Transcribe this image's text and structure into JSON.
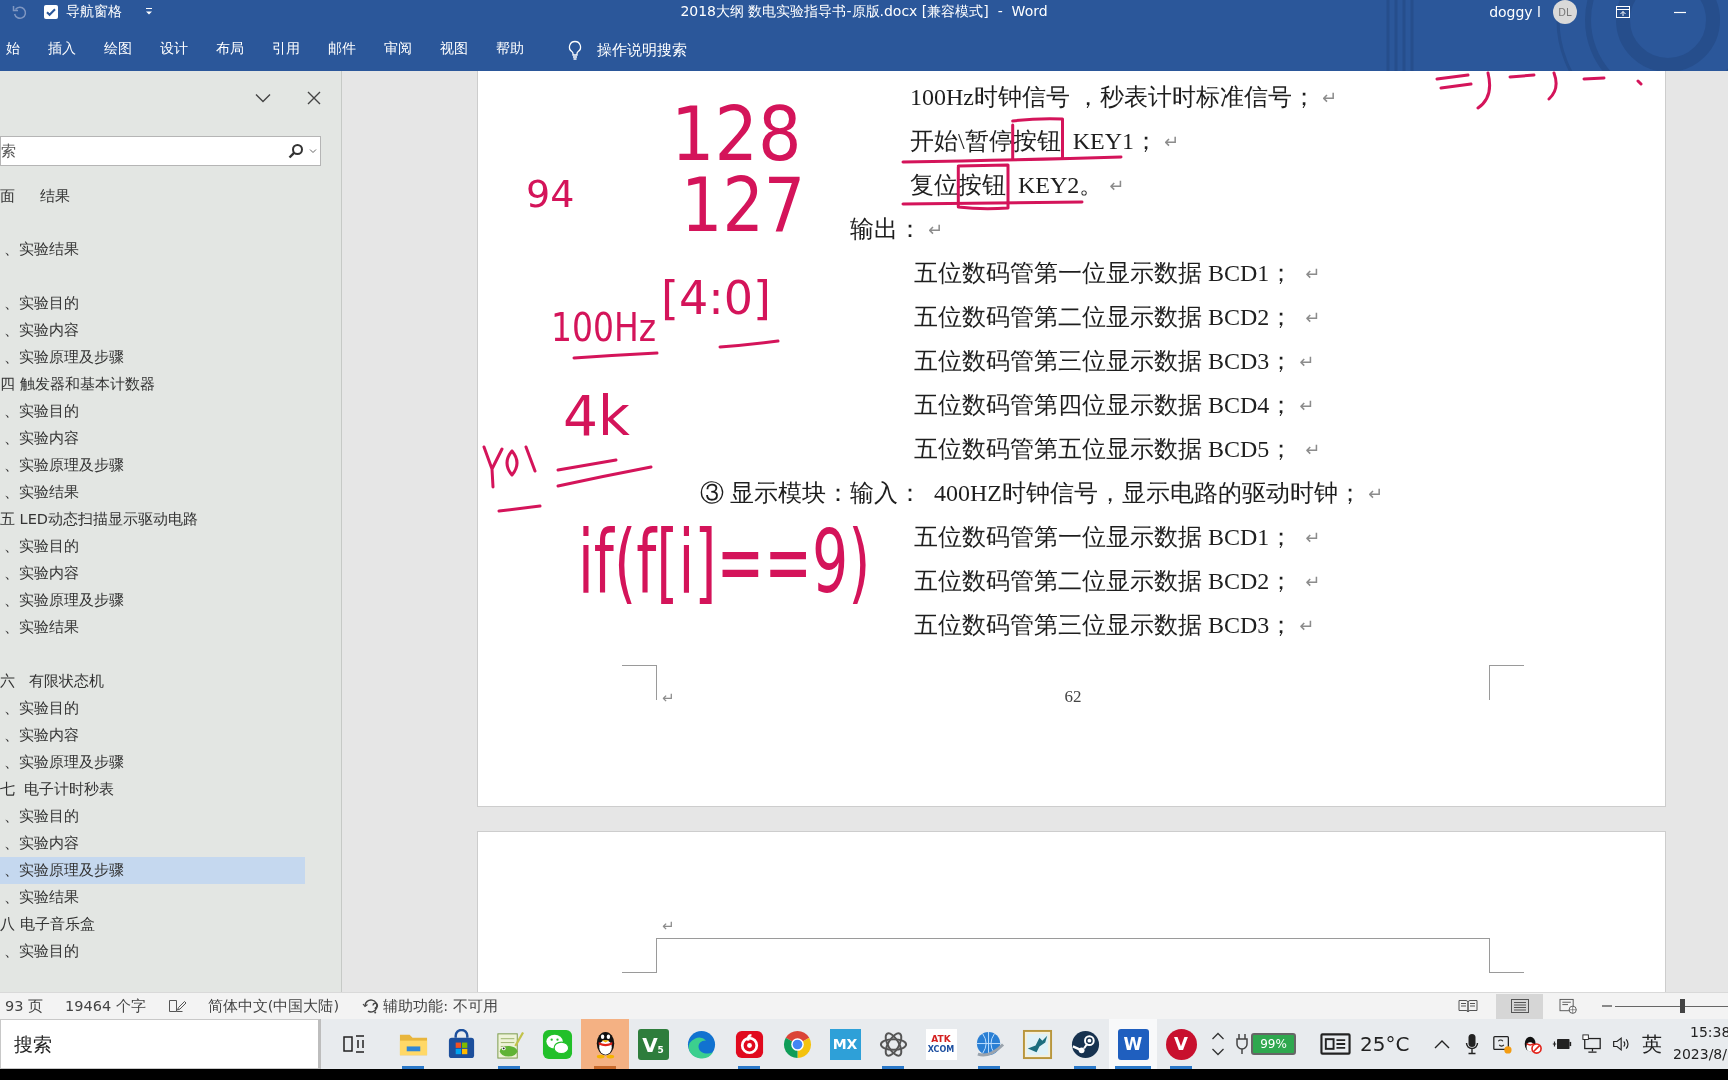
{
  "title_bar": {
    "undo": {
      "disabled": true
    },
    "nav_checkbox": {
      "label": "导航窗格",
      "checked": true
    },
    "title": "2018大纲 数电实验指导书-原版.docx [兼容模式]  -  Word",
    "user": "doggy l",
    "avatar": "DL"
  },
  "ribbon": {
    "tabs": [
      {
        "label": "始",
        "selected": false
      },
      {
        "label": "插入",
        "selected": false
      },
      {
        "label": "绘图",
        "selected": false
      },
      {
        "label": "设计",
        "selected": false
      },
      {
        "label": "布局",
        "selected": false
      },
      {
        "label": "引用",
        "selected": false
      },
      {
        "label": "邮件",
        "selected": false
      },
      {
        "label": "审阅",
        "selected": false
      },
      {
        "label": "视图",
        "selected": false
      },
      {
        "label": "帮助",
        "selected": false
      }
    ],
    "tell_me": "操作说明搜索"
  },
  "nav_pane": {
    "search": {
      "placeholder": "索"
    },
    "tabs": [
      {
        "label": "面",
        "selected": false
      },
      {
        "label": "结果",
        "selected": false
      }
    ],
    "tree": [
      {
        "kind": "entry",
        "text": "、实验结果",
        "selected": false
      },
      {
        "kind": "blank",
        "children": [
          {
            "kind": "entry",
            "text": "、实验目的",
            "selected": false
          },
          {
            "kind": "entry",
            "text": "、实验内容",
            "selected": false
          },
          {
            "kind": "entry",
            "text": "、实验原理及步骤",
            "selected": false
          }
        ]
      },
      {
        "kind": "heading",
        "text": "四 触发器和基本计数器",
        "selected": false,
        "children": [
          {
            "kind": "entry",
            "text": "、实验目的",
            "selected": false
          },
          {
            "kind": "entry",
            "text": "、实验内容",
            "selected": false
          },
          {
            "kind": "entry",
            "text": "、实验原理及步骤",
            "selected": false
          },
          {
            "kind": "entry",
            "text": "、实验结果",
            "selected": false
          }
        ]
      },
      {
        "kind": "heading",
        "text": "五 LED动态扫描显示驱动电路",
        "selected": false,
        "children": [
          {
            "kind": "entry",
            "text": "、实验目的",
            "selected": false
          },
          {
            "kind": "entry",
            "text": "、实验内容",
            "selected": false
          },
          {
            "kind": "entry",
            "text": "、实验原理及步骤",
            "selected": false
          },
          {
            "kind": "entry",
            "text": "、实验结果",
            "selected": false
          }
        ]
      },
      {
        "kind": "blank"
      },
      {
        "kind": "heading",
        "text": "六   有限状态机",
        "selected": false,
        "children": [
          {
            "kind": "entry",
            "text": "、实验目的",
            "selected": false
          },
          {
            "kind": "entry",
            "text": "、实验内容",
            "selected": false
          },
          {
            "kind": "entry",
            "text": "、实验原理及步骤",
            "selected": false
          }
        ]
      },
      {
        "kind": "heading",
        "text": "七  电子计时秒表",
        "selected": false,
        "children": [
          {
            "kind": "entry",
            "text": "、实验目的",
            "selected": false
          },
          {
            "kind": "entry",
            "text": "、实验内容",
            "selected": false
          },
          {
            "kind": "entry",
            "text": "、实验原理及步骤",
            "selected": true
          },
          {
            "kind": "entry",
            "text": "、实验结果",
            "selected": false
          }
        ]
      },
      {
        "kind": "heading",
        "text": "八 电子音乐盒",
        "selected": false,
        "children": [
          {
            "kind": "entry",
            "text": "、实验目的",
            "selected": false
          }
        ]
      }
    ]
  },
  "document": {
    "pages": [
      {
        "lines": [
          {
            "kind": "input",
            "text": "100Hz时钟信号 ，秒表计时标准信号；",
            "mark": "↵"
          },
          {
            "kind": "input",
            "text": "开始\\暂停按钮  KEY1；",
            "mark": "↵"
          },
          {
            "kind": "input",
            "text": "复位按钮  KEY2。",
            "mark": "↵"
          },
          {
            "kind": "label",
            "text": "输出：",
            "mark": "↵"
          },
          {
            "kind": "item",
            "text": "五位数码管第一位显示数据 BCD1； ",
            "mark": "↵"
          },
          {
            "kind": "item",
            "text": "五位数码管第二位显示数据 BCD2； ",
            "mark": "↵"
          },
          {
            "kind": "item",
            "text": "五位数码管第三位显示数据 BCD3；",
            "mark": "↵"
          },
          {
            "kind": "item",
            "text": "五位数码管第四位显示数据 BCD4；",
            "mark": "↵"
          },
          {
            "kind": "item",
            "text": "五位数码管第五位显示数据 BCD5； ",
            "mark": "↵"
          },
          {
            "kind": "module",
            "text": "③ 显示模块：输入：  400HZ时钟信号，显示电路的驱动时钟；",
            "mark": "↵"
          },
          {
            "kind": "item",
            "text": "五位数码管第一位显示数据 BCD1； ",
            "mark": "↵"
          },
          {
            "kind": "item",
            "text": "五位数码管第二位显示数据 BCD2； ",
            "mark": "↵"
          },
          {
            "kind": "item",
            "text": "五位数码管第三位显示数据 BCD3；",
            "mark": "↵"
          }
        ],
        "footer_mark": "↵",
        "page_number": "62"
      },
      {
        "header_mark": "↵"
      }
    ]
  },
  "ink_notes": [
    {
      "text": "128"
    },
    {
      "text": "94"
    },
    {
      "text": "127"
    },
    {
      "text": "100Hz"
    },
    {
      "text": "[4:0]"
    },
    {
      "text": "4k"
    },
    {
      "text": "if(f[i]==9)"
    }
  ],
  "status_bar": {
    "page_count": "93 页",
    "word_count": "19464 个字",
    "language": "简体中文(中国大陆)",
    "accessibility": "辅助功能: 不可用",
    "views": [
      {
        "kind": "read",
        "selected": false
      },
      {
        "kind": "print",
        "selected": true
      },
      {
        "kind": "web",
        "selected": false
      }
    ],
    "zoom": {
      "level": 0.59
    }
  },
  "taskbar": {
    "search": {
      "placeholder": "搜索"
    },
    "apps": [
      {
        "kind": "folder",
        "running": true,
        "selected": false,
        "flashing": false
      },
      {
        "kind": "store",
        "running": false,
        "selected": false,
        "flashing": false
      },
      {
        "kind": "notepad",
        "running": true,
        "selected": false,
        "flashing": false
      },
      {
        "kind": "chat",
        "running": false,
        "selected": false,
        "flashing": false
      },
      {
        "kind": "penguin",
        "running": true,
        "selected": false,
        "flashing": true
      },
      {
        "kind": "v5",
        "labels": [
          "V",
          "5"
        ],
        "running": false,
        "selected": false,
        "flashing": false
      },
      {
        "kind": "edge",
        "running": false,
        "selected": false,
        "flashing": false
      },
      {
        "kind": "music",
        "running": true,
        "selected": false,
        "flashing": false
      },
      {
        "kind": "chrome",
        "running": false,
        "selected": false,
        "flashing": false
      },
      {
        "kind": "mx",
        "labels": [
          "MX"
        ],
        "running": false,
        "selected": false,
        "flashing": false
      },
      {
        "kind": "knot",
        "running": true,
        "selected": false,
        "flashing": false
      },
      {
        "kind": "xcom",
        "labels": [
          "ATK",
          "XCOM"
        ],
        "running": false,
        "selected": false,
        "flashing": false
      },
      {
        "kind": "globe",
        "running": true,
        "selected": false,
        "flashing": false
      },
      {
        "kind": "bird",
        "running": false,
        "selected": false,
        "flashing": false
      },
      {
        "kind": "steam",
        "running": true,
        "selected": false,
        "flashing": false
      },
      {
        "kind": "word",
        "labels": [
          "W"
        ],
        "running": true,
        "selected": true,
        "flashing": false
      },
      {
        "kind": "vcircle",
        "labels": [
          "V"
        ],
        "running": true,
        "selected": false,
        "flashing": false
      }
    ],
    "tray": {
      "battery": "99%",
      "temperature": "25°C",
      "input_method": "英",
      "time": "15:38",
      "date": "2023/8/"
    }
  }
}
